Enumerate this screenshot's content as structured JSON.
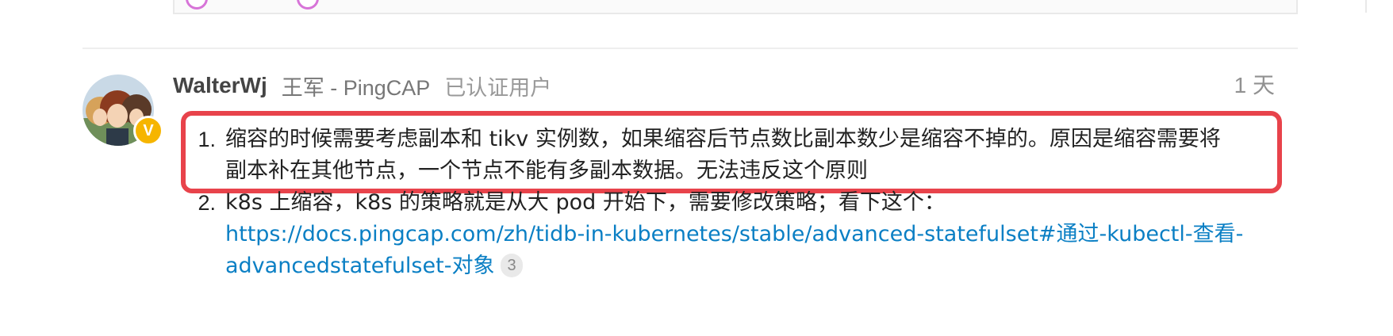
{
  "post": {
    "username": "WalterWj",
    "full_name": "王军 - PingCAP",
    "user_title": "已认证用户",
    "timestamp": "1 天",
    "badge_letter": "V",
    "list": [
      {
        "number": "1.",
        "lines": [
          "缩容的时候需要考虑副本和 tikv 实例数，如果缩容后节点数比副本数少是缩容不掉的。原因是缩容需要将",
          "副本补在其他节点，一个节点不能有多副本数据。无法违反这个原则"
        ]
      },
      {
        "number": "2.",
        "text": "k8s 上缩容，k8s 的策略就是从大 pod 开始下，需要修改策略；看下这个：",
        "link_line1": "https://docs.pingcap.com/zh/tidb-in-kubernetes/stable/advanced-statefulset#通过-kubectl-查看-",
        "link_line2": "advancedstatefulset-对象",
        "link_click_count": "3"
      }
    ]
  },
  "colors": {
    "highlight_border": "#e8434b",
    "link": "#0a7fc4",
    "badge": "#f6b500"
  },
  "icons": {
    "avatar": "user-avatar",
    "badge": "verified-badge-icon"
  }
}
